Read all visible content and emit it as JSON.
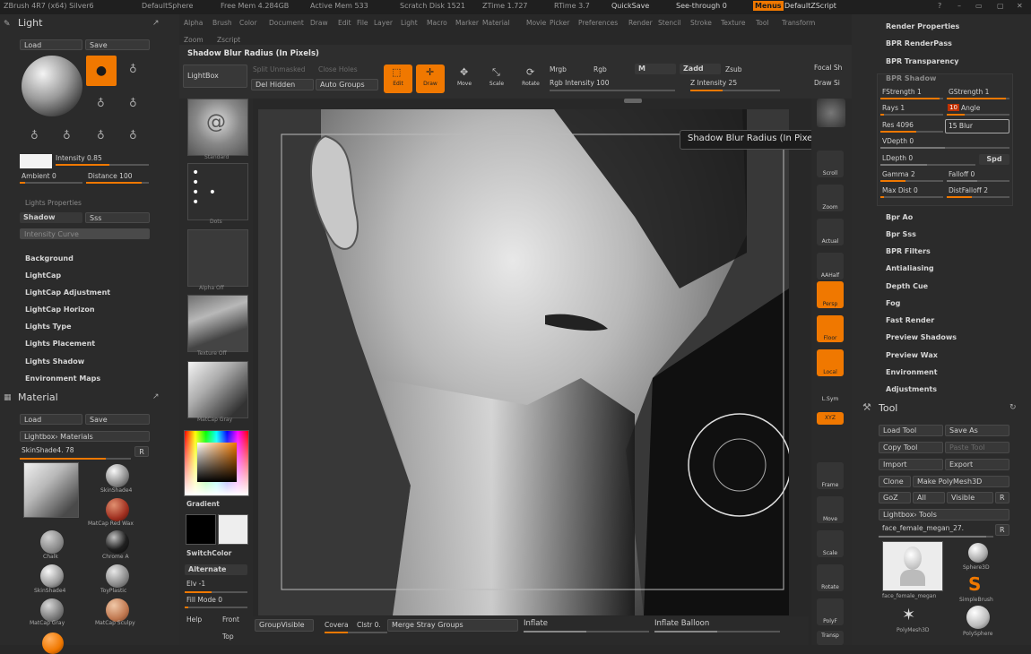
{
  "titlebar": {
    "app": "ZBrush 4R7 (x64) Silver6",
    "material_name": "DefaultSphere",
    "free_mem": "Free Mem 4.284GB",
    "active_mem": "Active Mem 533",
    "scratch_disk": "Scratch Disk 1521",
    "ztime": "ZTime 1.727",
    "rtime": "RTime 3.7",
    "quicksave": "QuickSave",
    "see_through": "See-through  0",
    "menus": "Menus",
    "script": "DefaultZScript"
  },
  "menu": [
    "Alpha",
    "Brush",
    "Color",
    "Document",
    "Draw",
    "Edit",
    "File",
    "Layer",
    "Light",
    "Macro",
    "Marker",
    "Material",
    "Movie",
    "Picker",
    "Preferences",
    "Render",
    "Stencil",
    "Stroke",
    "Texture",
    "Tool",
    "Transform"
  ],
  "menu2": [
    "Zoom",
    "Zscript"
  ],
  "tooltip_title": "Shadow Blur Radius (In Pixels)",
  "tooltip_popup": "Shadow Blur Radius (In Pixels)",
  "light": {
    "title": "Light",
    "load": "Load",
    "save": "Save",
    "intensity": "Intensity 0.85",
    "ambient": "Ambient 0",
    "distance": "Distance 100",
    "lights_properties": "Lights Properties",
    "shadow": "Shadow",
    "sss": "Sss",
    "intensity_curve": "Intensity Curve",
    "subpalettes": [
      "Background",
      "LightCap",
      "LightCap Adjustment",
      "LightCap Horizon",
      "Lights Type",
      "Lights Placement",
      "Lights Shadow",
      "Environment Maps"
    ]
  },
  "material": {
    "title": "Material",
    "load": "Load",
    "save": "Save",
    "lightbox": "Lightbox› Materials",
    "current": "SkinShade4. 78",
    "r": "R",
    "items": [
      "SkinShade4",
      "MatCap Red Wax",
      "Chalk",
      "Chrome A",
      "SkinShade4",
      "ToyPlastic",
      "MatCap Gray",
      "MatCap Sculpy"
    ]
  },
  "topshelf": {
    "lightbox": "LightBox",
    "edit": "Edit",
    "draw": "Draw",
    "move": "Move",
    "scale": "Scale",
    "rotate": "Rotate",
    "mrgb": "Mrgb",
    "rgb": "Rgb",
    "m": "M",
    "zadd": "Zadd",
    "zsub": "Zsub",
    "rgb_intensity": "Rgb Intensity 100",
    "z_intensity": "Z Intensity 25",
    "focal": "Focal Sh",
    "draw_size": "Draw Si",
    "del_hidden": "Del Hidden",
    "auto_groups": "Auto Groups",
    "split_unmasked": "Split Unmasked",
    "close_holes": "Close Holes"
  },
  "leftshelf": {
    "gradient": "Gradient",
    "switchcolor": "SwitchColor",
    "alternate": "Alternate",
    "elv": "Elv -1",
    "fill_mode": "Fill Mode 0",
    "help": "Help",
    "front": "Front",
    "top": "Top",
    "thumbs": [
      "Standard",
      "Dots",
      "Alpha Off",
      "Texture Off",
      "MatCap Gray"
    ]
  },
  "rightshelf": [
    "BPR",
    "Scroll",
    "Zoom",
    "Actual",
    "AAHalf",
    "Persp",
    "Floor",
    "Local",
    "L.Sym",
    "XYZ",
    "Frame",
    "Move",
    "Scale",
    "Rotate",
    "PolyF",
    "Transp"
  ],
  "bottombar": {
    "group_visible": "GroupVisible",
    "coverage": "Covera",
    "clstr": "Clstr 0.",
    "merge_stray": "Merge Stray Groups",
    "inflate": "Inflate",
    "inflate_balloon": "Inflate Balloon"
  },
  "render": {
    "items_top": [
      "Render Properties",
      "BPR RenderPass",
      "BPR Transparency",
      "BPR Shadow"
    ],
    "fstrength": "FStrength 1",
    "gstrength": "GStrength 1",
    "rays": "Rays 1",
    "angle_val": "10",
    "angle": "Angle",
    "res": "Res 4096",
    "blur": "15 Blur",
    "vdepth": "VDepth 0",
    "ldepth": "LDepth 0",
    "spd": "Spd",
    "gamma": "Gamma 2",
    "falloff": "Falloff 0",
    "max_dist": "Max Dist 0",
    "dist_falloff": "DistFalloff 2",
    "items_bottom": [
      "Bpr Ao",
      "Bpr Sss",
      "BPR Filters",
      "Antialiasing",
      "Depth Cue",
      "Fog",
      "Fast Render",
      "Preview Shadows",
      "Preview Wax",
      "Environment",
      "Adjustments"
    ]
  },
  "tool": {
    "title": "Tool",
    "load": "Load Tool",
    "save_as": "Save As",
    "copy": "Copy Tool",
    "paste": "Paste Tool",
    "import": "Import",
    "export": "Export",
    "clone": "Clone",
    "make_polymesh": "Make PolyMesh3D",
    "goz": "GoZ",
    "all": "All",
    "visible": "Visible",
    "r": "R",
    "lightbox_tools": "Lightbox› Tools",
    "current": "face_female_megan_27.",
    "tools": [
      "face_female_megan",
      "Sphere3D",
      "SimpleBrush",
      "PolyMesh3D",
      "PolySphere"
    ]
  },
  "colors": {
    "accent": "#f07800",
    "panel": "#2b2b2b",
    "bg": "#282828"
  }
}
